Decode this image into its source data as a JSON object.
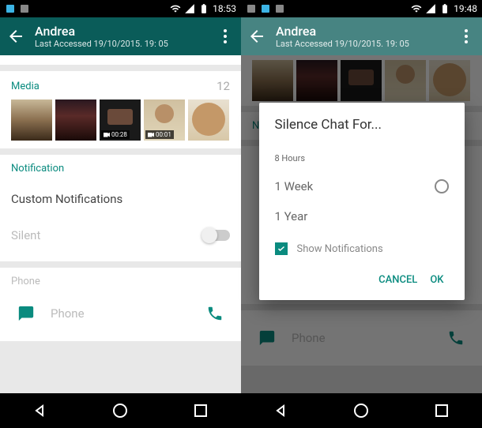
{
  "left": {
    "status": {
      "time": "18:53"
    },
    "header": {
      "name": "Andrea",
      "last_accessed": "Last Accessed 19/10/2015. 19: 05"
    },
    "media": {
      "label": "Media",
      "count": "12",
      "items": [
        {
          "badge": ""
        },
        {
          "badge": ""
        },
        {
          "badge": "00:28"
        },
        {
          "badge": "00:01"
        },
        {
          "badge": ""
        }
      ]
    },
    "notification": {
      "header": "Notification",
      "custom": "Custom Notifications",
      "silent": "Silent"
    },
    "phone": {
      "header": "Phone",
      "label": "Phone"
    }
  },
  "right": {
    "status": {
      "time": "19:48"
    },
    "header": {
      "name": "Andrea",
      "last_accessed": "Last Accessed 19/10/2015. 19: 05"
    },
    "bg": {
      "notifiche": "Notifiche",
      "phone_label": "Phone"
    },
    "dialog": {
      "title": "Silence Chat For...",
      "options": [
        {
          "label": "8 Hours"
        },
        {
          "label": "1 Week"
        },
        {
          "label": "1 Year"
        }
      ],
      "show_notifications": "Show Notifications",
      "cancel": "CANCEL",
      "ok": "OK"
    }
  },
  "colors": {
    "teal": "#0a8b7f",
    "header": "#0a5c59"
  }
}
